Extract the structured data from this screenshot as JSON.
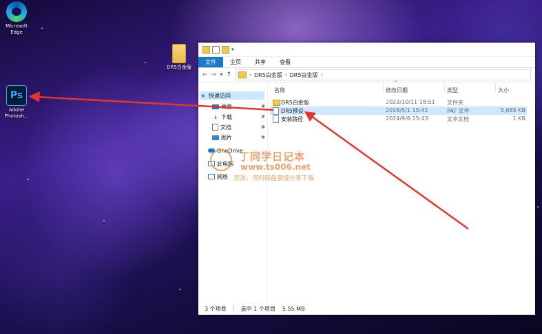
{
  "desktop": {
    "icons": [
      {
        "label1": "Microsoft",
        "label2": "Edge",
        "icon": "edge-icon"
      },
      {
        "label1": "Adobe",
        "label2": "Photosh...",
        "icon": "photoshop-icon",
        "logo_text": "Ps"
      },
      {
        "label1": "DR5白金版",
        "icon": "folder-icon"
      }
    ]
  },
  "explorer": {
    "ribbon_tabs": [
      "文件",
      "主页",
      "共享",
      "查看"
    ],
    "path": [
      "DR5白金版",
      "DR5白金版"
    ],
    "nav_pane": [
      {
        "label": "快速访问",
        "icon": "star-icon"
      },
      {
        "label": "桌面",
        "icon": "desktop-icon"
      },
      {
        "label": "下载",
        "icon": "download-icon"
      },
      {
        "label": "文档",
        "icon": "document-icon"
      },
      {
        "label": "图片",
        "icon": "picture-icon"
      },
      {
        "label": "OneDrive",
        "icon": "cloud-icon"
      },
      {
        "label": "此电脑",
        "icon": "computer-icon"
      },
      {
        "label": "网络",
        "icon": "network-icon"
      }
    ],
    "columns": [
      "名称",
      "修改日期",
      "类型",
      "大小"
    ],
    "files": [
      {
        "name": "DR5白金版",
        "date": "2023/10/11 18:51",
        "type": "文件夹",
        "size": "",
        "icon": "folder-icon"
      },
      {
        "name": "DR5预设",
        "date": "2018/5/1 15:41",
        "type": "PAT 文件",
        "size": "5,685 KB",
        "icon": "pat-file-icon"
      },
      {
        "name": "安装路径",
        "date": "2024/9/6 15:43",
        "type": "文本文档",
        "size": "1 KB",
        "icon": "text-file-icon"
      }
    ],
    "status": {
      "count": "3 个项目",
      "selected": "选中 1 个项目",
      "size": "5.55 MB"
    }
  },
  "watermark": {
    "line1": "丁同学日记本",
    "line2": "www.ts006.net",
    "line3": "资源，资料网盘直接分享下载"
  },
  "annotation_color": "#e8352b"
}
